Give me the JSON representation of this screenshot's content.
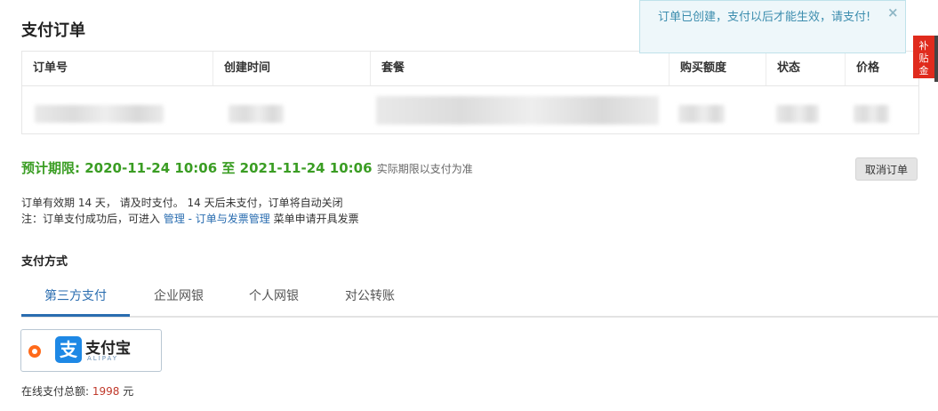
{
  "page": {
    "title": "支付订单"
  },
  "order_table": {
    "headers": [
      "订单号",
      "创建时间",
      "套餐",
      "购买额度",
      "状态",
      "价格"
    ]
  },
  "period": {
    "label": "预计期限:",
    "start": "2020-11-24 10:06",
    "to": "至",
    "end": "2021-11-24 10:06",
    "note": "实际期限以支付为准"
  },
  "actions": {
    "cancel_order": "取消订单"
  },
  "info": {
    "line1": "订单有效期 14 天， 请及时支付。 14 天后未支付，订单将自动关闭",
    "line2_prefix": "注：订单支付成功后，可进入",
    "line2_link": "管理 - 订单与发票管理",
    "line2_suffix": "菜单申请开具发票"
  },
  "payment": {
    "section_title": "支付方式",
    "tabs": [
      "第三方支付",
      "企业网银",
      "个人网银",
      "对公转账"
    ],
    "active_tab": 0,
    "method": {
      "name": "支付宝",
      "sub": "ALIPAY",
      "logo_char": "支",
      "selected": true
    },
    "total_label": "在线支付总额:",
    "total_amount": "1998",
    "total_unit": "元"
  },
  "toast": {
    "message": "订单已创建，支付以后才能生效，请支付!",
    "close": "×"
  },
  "side_badge": {
    "text": "补\n贴\n金"
  },
  "colors": {
    "period_green": "#3a9d23",
    "link_blue": "#2a6db0",
    "amount_red": "#c0392b",
    "alipay_blue": "#1e88e5",
    "radio_orange": "#ff6a1a",
    "badge_red": "#e02b1d"
  }
}
